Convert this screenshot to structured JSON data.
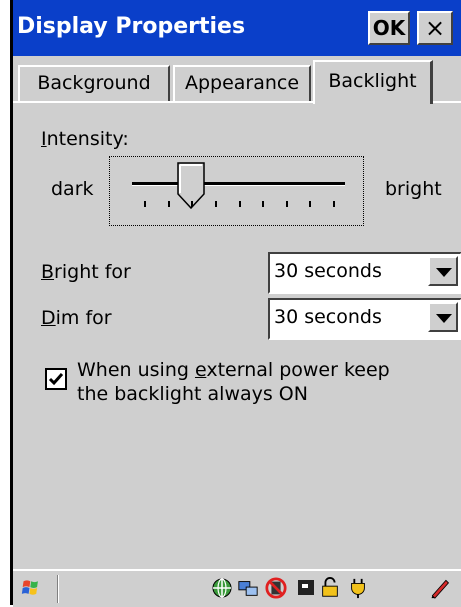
{
  "window": {
    "title": "Display Properties",
    "ok_label": "OK",
    "close_label": "×"
  },
  "tabs": [
    {
      "label": "Background",
      "selected": false
    },
    {
      "label": "Appearance",
      "selected": false
    },
    {
      "label": "Backlight",
      "selected": true
    }
  ],
  "backlight": {
    "intensity_label_access": "I",
    "intensity_label_rest": "ntensity:",
    "slider_min_label": "dark",
    "slider_max_label": "bright",
    "slider_level": 0.25,
    "bright_for_label_access": "B",
    "bright_for_label_rest": "right for",
    "bright_for_value": "30 seconds",
    "dim_for_label_access": "D",
    "dim_for_label_rest": "im for",
    "dim_for_value": "30 seconds",
    "external_power_text_1": "When using ",
    "external_power_text_access": "e",
    "external_power_text_2": "xternal power keep",
    "external_power_text_3": "the backlight always ON",
    "external_power_checked": true
  },
  "taskbar": {
    "start_icon": "windows-flag-icon",
    "tray_icons": [
      "network-globe-icon",
      "connection-icon",
      "no-signal-icon",
      "card-icon",
      "lock-icon",
      "power-plug-icon",
      "pen-icon"
    ]
  },
  "colors": {
    "titlebar": "#0a3fc9",
    "face": "#cfcfcf"
  }
}
